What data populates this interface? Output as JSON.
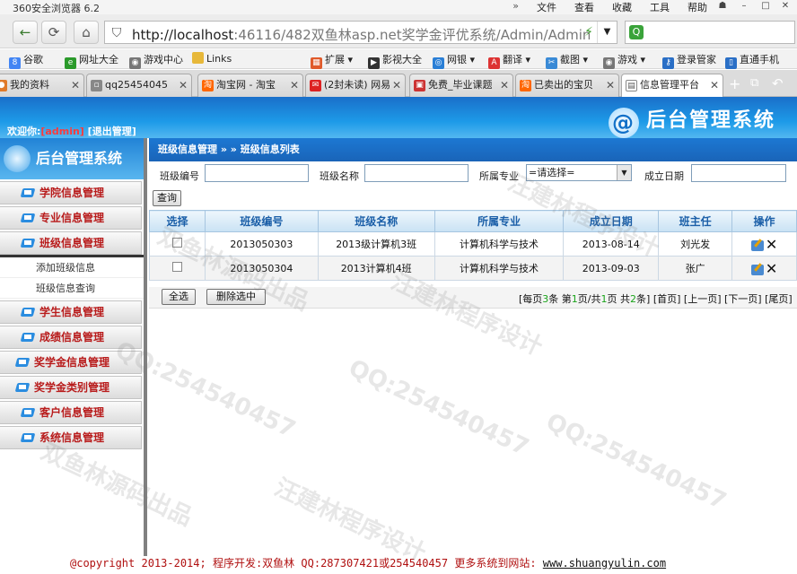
{
  "browser": {
    "title": "360安全浏览器 6.2",
    "menus": [
      "文件",
      "查看",
      "收藏",
      "工具",
      "帮助"
    ],
    "url_host": "http://localhost",
    "url_rest": ":46116/482双鱼林asp.net奖学金评优系统/Admin/AdminInde:",
    "favorites": [
      "谷歌",
      "网址大全",
      "游戏中心",
      "Links",
      "扩展",
      "影视大全",
      "网银",
      "翻译",
      "截图",
      "游戏",
      "登录管家",
      "直通手机"
    ],
    "tabs": [
      "我的资料",
      "qq25454045",
      "淘宝网 - 淘宝",
      "(2封未读) 网易",
      "免费_毕业课题",
      "已卖出的宝贝",
      "信息管理平台"
    ]
  },
  "page": {
    "welcome_label": "欢迎你:",
    "welcome_user": "[admin]",
    "logout": "[退出管理]",
    "brand": "后台管理系统",
    "side_title": "后台管理系统"
  },
  "sidebar": {
    "items": [
      "学院信息管理",
      "专业信息管理",
      "班级信息管理"
    ],
    "subitems": [
      "添加班级信息",
      "班级信息查询"
    ],
    "items2": [
      "学生信息管理",
      "成绩信息管理",
      "奖学金信息管理",
      "奖学金类别管理",
      "客户信息管理",
      "系统信息管理"
    ]
  },
  "main": {
    "breadcrumb": "班级信息管理 » » 班级信息列表",
    "filter": {
      "class_no_label": "班级编号",
      "class_name_label": "班级名称",
      "major_label": "所属专业",
      "major_value": "=请选择=",
      "date_label": "成立日期",
      "query_button": "查询"
    },
    "table": {
      "headers": [
        "选择",
        "班级编号",
        "班级名称",
        "所属专业",
        "成立日期",
        "班主任",
        "操作"
      ],
      "rows": [
        [
          "2013050303",
          "2013级计算机3班",
          "计算机科学与技术",
          "2013-08-14",
          "刘光发"
        ],
        [
          "2013050304",
          "2013计算机4班",
          "计算机科学与技术",
          "2013-09-03",
          "张广"
        ]
      ]
    },
    "select_all": "全选",
    "delete_selected": "删除选中",
    "pager": {
      "pre": "[每页",
      "per_page": "3",
      "mid1": "条 第",
      "current": "1",
      "mid2": "页/共",
      "total_pages": "1",
      "mid3": "页 共",
      "total": "2",
      "post": "条]",
      "first": "[首页]",
      "prev": "[上一页]",
      "next": "[下一页]",
      "last": "[尾页]"
    }
  },
  "footer": {
    "text": "@copyright 2013-2014; 程序开发:双鱼林  QQ:287307421或254540457  更多系统到网站:",
    "site": "www.shuangyulin.com"
  },
  "watermarks": [
    "汪建林程序设计",
    "QQ:254540457",
    "双鱼林源码出品"
  ],
  "colors": {
    "header_blue": "#1d9ae8",
    "menu_text": "#b81b1b",
    "table_header_text": "#1b5fa8"
  }
}
